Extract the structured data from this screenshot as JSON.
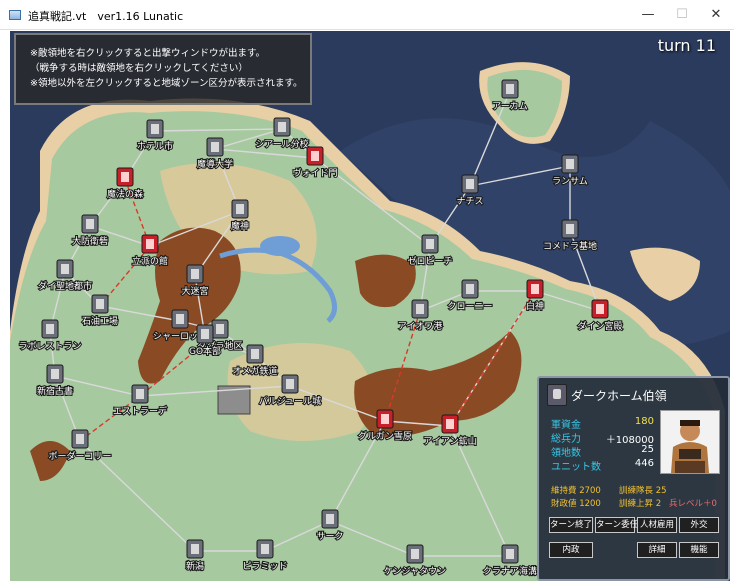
{
  "window": {
    "title": "追真戦記.vt　ver1.16  Lunatic",
    "minimize_glyph": "—",
    "maximize_glyph": "☐",
    "close_glyph": "✕"
  },
  "help": {
    "lines": [
      "※敵領地を右クリックすると出撃ウィンドウが出ます。",
      "（戦争する時は敵領地を右クリックしてください）",
      "※領地以外を左クリックすると地域ゾーン区分が表示されます。"
    ]
  },
  "turn": "turn 11",
  "colors": {
    "sea": "#2b3b5d",
    "land": "#a7c9a0",
    "beach": "#e8cfa5",
    "mountain": "#8a4a24",
    "road": "#d9d9d9",
    "war_line": "#d83a2a",
    "player_flag": "#d8d8d8",
    "enemy_red": "#c8202a",
    "enemy_purple": "#b04aa8"
  },
  "cities": [
    {
      "name": "ホテル市",
      "faction": "gray"
    },
    {
      "name": "シアール分校",
      "faction": "gray"
    },
    {
      "name": "魔法の森",
      "faction": "red"
    },
    {
      "name": "魔導大学",
      "faction": "gray"
    },
    {
      "name": "大防衛砦",
      "faction": "gray"
    },
    {
      "name": "魔神",
      "faction": "gray"
    },
    {
      "name": "ヴォイド門",
      "faction": "red"
    },
    {
      "name": "立派の館",
      "faction": "red"
    },
    {
      "name": "ダイ聖地都市",
      "faction": "gray"
    },
    {
      "name": "ラボレストラン",
      "faction": "gray"
    },
    {
      "name": "石油工場",
      "faction": "gray"
    },
    {
      "name": "シャーロット",
      "faction": "gray"
    },
    {
      "name": "ダグラ地区",
      "faction": "gray"
    },
    {
      "name": "大迷宮",
      "faction": "gray"
    },
    {
      "name": "GO本部",
      "faction": "gray"
    },
    {
      "name": "オメガ鉄道",
      "faction": "gray"
    },
    {
      "name": "新宿古書",
      "faction": "gray"
    },
    {
      "name": "エストラーデ",
      "faction": "gray"
    },
    {
      "name": "アーカム",
      "faction": "gray"
    },
    {
      "name": "ナチス",
      "faction": "gray"
    },
    {
      "name": "コメドラ基地",
      "faction": "gray"
    },
    {
      "name": "ゼロビーチ",
      "faction": "gray"
    },
    {
      "name": "ランサム",
      "faction": "gray"
    },
    {
      "name": "アイオワ港",
      "faction": "gray"
    },
    {
      "name": "クローニー",
      "faction": "gray"
    },
    {
      "name": "パルジュール城",
      "faction": "gray"
    },
    {
      "name": "グルガン雪原",
      "faction": "red"
    },
    {
      "name": "アイアン鉱山",
      "faction": "red"
    },
    {
      "name": "白神",
      "faction": "red"
    },
    {
      "name": "ダイン宮殿",
      "faction": "red"
    },
    {
      "name": "ボーダーコリー",
      "faction": "gray"
    },
    {
      "name": "新潟",
      "faction": "gray"
    },
    {
      "name": "ピラミッド",
      "faction": "gray"
    },
    {
      "name": "サーク",
      "faction": "gray"
    },
    {
      "name": "クラナア海溝",
      "faction": "gray"
    },
    {
      "name": "ケンジャタウン",
      "faction": "gray"
    }
  ],
  "info_panel": {
    "lord_name": "ダークホーム伯領",
    "stats": [
      {
        "label": "軍資金",
        "value": "180"
      },
      {
        "label": "総兵力",
        "value": "＋108000"
      },
      {
        "label": "領地数",
        "value": "25"
      },
      {
        "label": "ユニット数",
        "value": "446"
      }
    ],
    "sub_stats": {
      "upkeep": "維持費 2700",
      "training": "訓練隊長 25",
      "income": "財政値 1200",
      "training_up": "訓練上昇 2",
      "soldier_level": "兵レベル＋0"
    },
    "buttons": {
      "end_turn": "ターン終了",
      "delegate": "ターン委任",
      "hire": "人材雇用",
      "diplomacy": "外交",
      "domestic": "内政",
      "settings": "詳細",
      "functions": "機能"
    }
  }
}
